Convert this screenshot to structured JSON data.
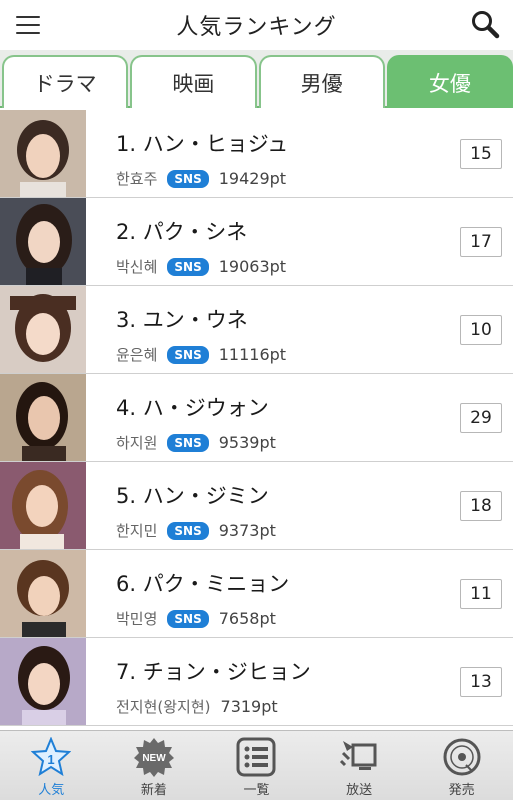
{
  "header": {
    "title": "人気ランキング",
    "menu_icon": "hamburger-menu-icon",
    "search_icon": "search-icon"
  },
  "tabs": [
    {
      "label": "ドラマ",
      "active": false
    },
    {
      "label": "映画",
      "active": false
    },
    {
      "label": "男優",
      "active": false
    },
    {
      "label": "女優",
      "active": true
    }
  ],
  "ranking": [
    {
      "name": "1. ハン・ヒョジュ",
      "korean": "한효주",
      "badge": "SNS",
      "points": "19429pt",
      "count": "15"
    },
    {
      "name": "2. パク・シネ",
      "korean": "박신혜",
      "badge": "SNS",
      "points": "19063pt",
      "count": "17"
    },
    {
      "name": "3. ユン・ウネ",
      "korean": "윤은혜",
      "badge": "SNS",
      "points": "11116pt",
      "count": "10"
    },
    {
      "name": "4. ハ・ジウォン",
      "korean": "하지원",
      "badge": "SNS",
      "points": "9539pt",
      "count": "29"
    },
    {
      "name": "5. ハン・ジミン",
      "korean": "한지민",
      "badge": "SNS",
      "points": "9373pt",
      "count": "18"
    },
    {
      "name": "6. パク・ミニョン",
      "korean": "박민영",
      "badge": "SNS",
      "points": "7658pt",
      "count": "11"
    },
    {
      "name": "7. チョン・ジヒョン",
      "korean": "전지현(왕지현)",
      "badge": "",
      "points": "7319pt",
      "count": "13"
    }
  ],
  "bottom_nav": [
    {
      "label": "人気",
      "icon": "star-rank-icon",
      "icon_text": "1",
      "active": true
    },
    {
      "label": "新着",
      "icon": "new-badge-icon",
      "icon_text": "NEW",
      "active": false
    },
    {
      "label": "一覧",
      "icon": "list-icon",
      "icon_text": "",
      "active": false
    },
    {
      "label": "放送",
      "icon": "broadcast-icon",
      "icon_text": "",
      "active": false
    },
    {
      "label": "発売",
      "icon": "disc-icon",
      "icon_text": "",
      "active": false
    }
  ],
  "colors": {
    "accent_green": "#6cbf72",
    "sns_blue": "#1f7fd6",
    "active_nav_blue": "#1f7fd6"
  }
}
